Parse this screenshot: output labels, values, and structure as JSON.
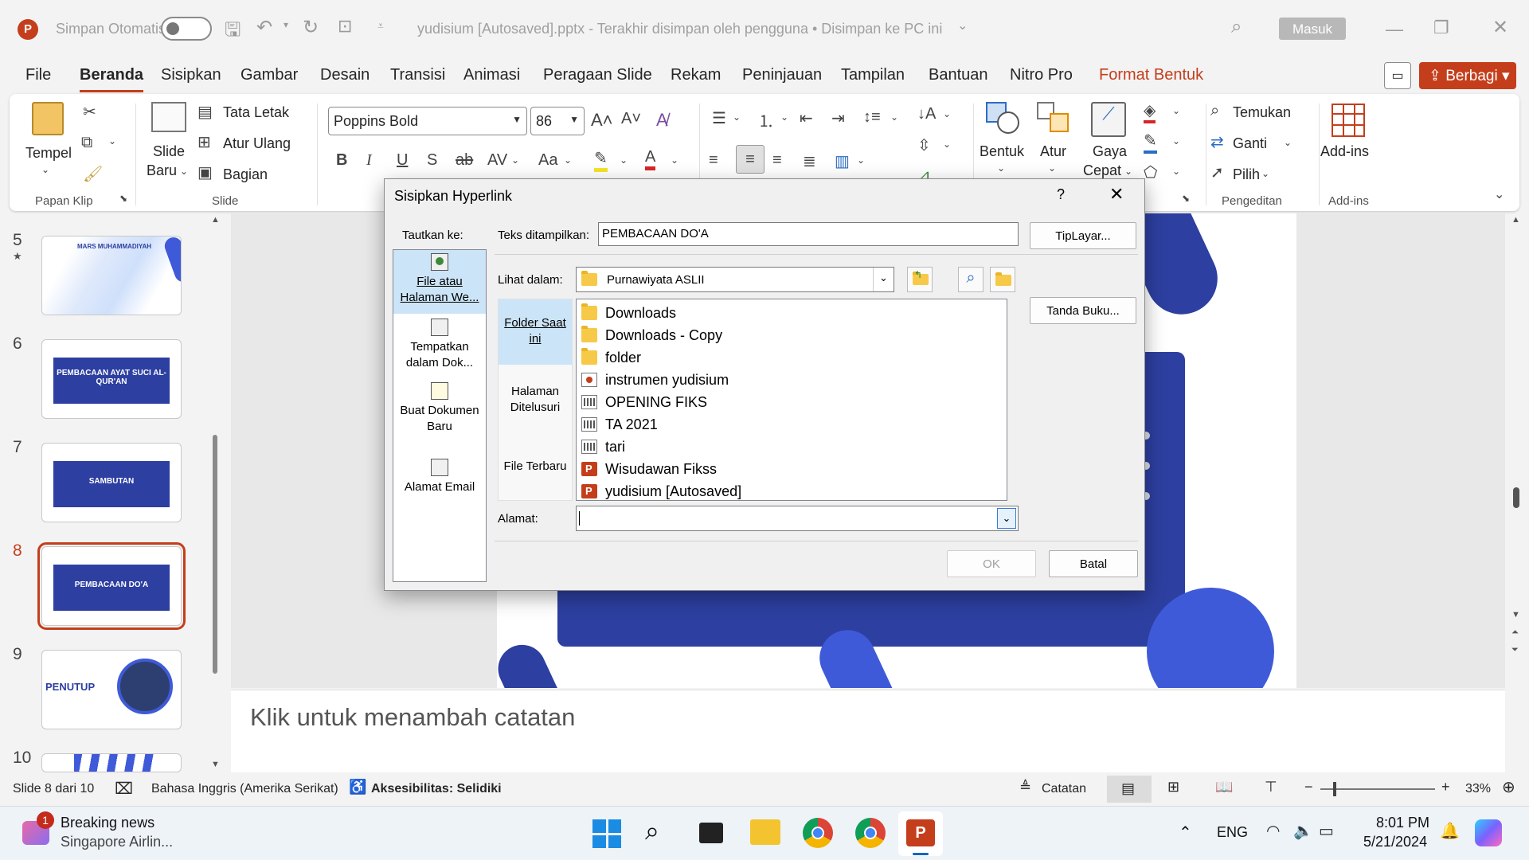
{
  "titlebar": {
    "autosave_label": "Simpan Otomatis",
    "doc_title": "yudisium [Autosaved].pptx  -  Terakhir disimpan oleh pengguna • Disimpan ke PC ini",
    "signin": "Masuk"
  },
  "menu": {
    "tabs": [
      "File",
      "Beranda",
      "Sisipkan",
      "Gambar",
      "Desain",
      "Transisi",
      "Animasi",
      "Peragaan Slide",
      "Rekam",
      "Peninjauan",
      "Tampilan",
      "Bantuan",
      "Nitro Pro",
      "Format Bentuk"
    ],
    "share": "Berbagi"
  },
  "ribbon": {
    "paste": "Tempel",
    "clipboard_group": "Papan Klip",
    "new_slide": "Slide",
    "new_slide2": "Baru",
    "layout": "Tata Letak",
    "reset": "Atur Ulang",
    "section": "Bagian",
    "slides_group": "Slide",
    "font": "Poppins Bold",
    "size": "86",
    "shapes": "Bentuk",
    "arrange": "Atur",
    "quick_styles": "Gaya",
    "quick_styles2": "Cepat",
    "find": "Temukan",
    "replace": "Ganti",
    "select": "Pilih",
    "editing_group": "Pengeditan",
    "addins": "Add-ins",
    "addins_group": "Add-ins"
  },
  "thumbnails": [
    {
      "num": "5",
      "text": "MARS MUHAMMADIYAH"
    },
    {
      "num": "6",
      "text": "PEMBACAAN AYAT SUCI AL-QUR'AN"
    },
    {
      "num": "7",
      "text": "SAMBUTAN"
    },
    {
      "num": "8",
      "text": "PEMBACAAN DO'A"
    },
    {
      "num": "9",
      "text": "PENUTUP"
    },
    {
      "num": "10",
      "text": ""
    }
  ],
  "notes_placeholder": "Klik untuk menambah catatan",
  "status": {
    "slide": "Slide 8 dari 10",
    "language": "Bahasa Inggris (Amerika Serikat)",
    "accessibility": "Aksesibilitas: Selidiki",
    "notes": "Catatan",
    "zoom": "33%"
  },
  "taskbar": {
    "news_title": "Breaking news",
    "news_sub": "Singapore Airlin...",
    "badge": "1",
    "lang": "ENG",
    "time": "8:01 PM",
    "date": "5/21/2024"
  },
  "dialog": {
    "title": "Sisipkan Hyperlink",
    "help": "?",
    "link_to": "Tautkan ke:",
    "link_items": [
      "File atau Halaman We...",
      "Tempatkan dalam Dok...",
      "Buat Dokumen Baru",
      "Alamat Email"
    ],
    "text_to_display_label": "Teks ditampilkan:",
    "text_to_display": "PEMBACAAN DO'A",
    "screentip": "TipLayar...",
    "look_in_label": "Lihat dalam:",
    "look_in": "Purnawiyata ASLII",
    "places": [
      "Folder Saat ini",
      "Halaman Ditelusuri",
      "File Terbaru"
    ],
    "files": [
      {
        "name": "Downloads",
        "type": "folder"
      },
      {
        "name": "Downloads - Copy",
        "type": "folder"
      },
      {
        "name": "folder",
        "type": "folder"
      },
      {
        "name": "instrumen yudisium",
        "type": "video"
      },
      {
        "name": "OPENING FIKS",
        "type": "clip"
      },
      {
        "name": "TA 2021",
        "type": "clip"
      },
      {
        "name": "tari",
        "type": "clip"
      },
      {
        "name": "Wisudawan Fikss",
        "type": "ppt"
      },
      {
        "name": "yudisium [Autosaved]",
        "type": "ppt"
      }
    ],
    "bookmark": "Tanda Buku...",
    "address_label": "Alamat:",
    "address": "",
    "ok": "OK",
    "cancel": "Batal"
  },
  "colors": {
    "accent": "#c43e1c",
    "slide_blue": "#2d3fa0",
    "select_blue": "#cce4f7"
  }
}
